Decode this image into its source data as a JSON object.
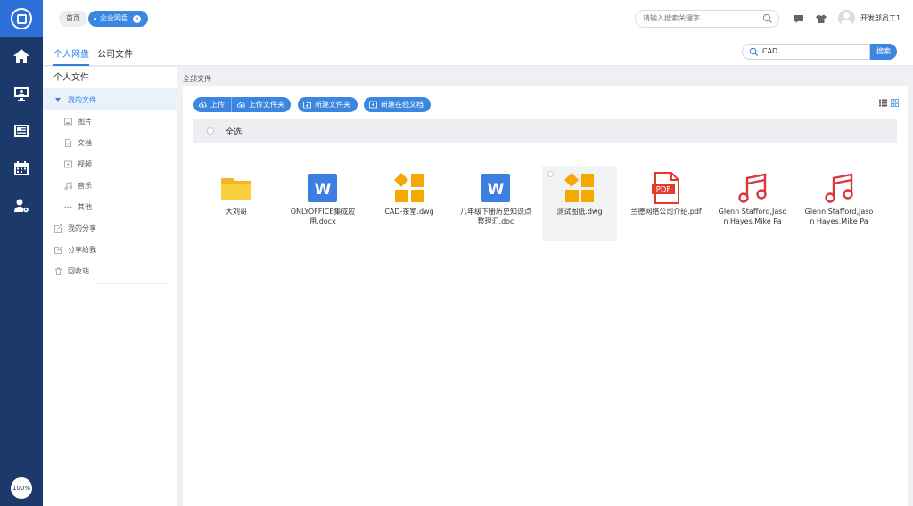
{
  "rail": {
    "items": [
      "home-icon",
      "monitor-user-icon",
      "news-icon",
      "calendar-icon",
      "user-settings-icon"
    ],
    "zoom": "100%"
  },
  "header": {
    "crumb_home": "首页",
    "crumb_tab": "企业网盘",
    "search_placeholder": "请输入搜索关键字",
    "username": "开发部员工1"
  },
  "tabs": {
    "items": [
      {
        "label": "个人网盘",
        "active": true
      },
      {
        "label": "公司文件",
        "active": false
      }
    ],
    "search_value": "CAD",
    "search_button": "搜索"
  },
  "tree": {
    "title": "个人文件",
    "my_files": "我的文件",
    "sub": [
      {
        "label": "图片",
        "icon": "image-icon"
      },
      {
        "label": "文档",
        "icon": "document-icon"
      },
      {
        "label": "视频",
        "icon": "video-icon"
      },
      {
        "label": "音乐",
        "icon": "music-icon"
      },
      {
        "label": "其他",
        "icon": "more-icon"
      }
    ],
    "links": [
      {
        "label": "我的分享",
        "icon": "share-icon"
      },
      {
        "label": "分享给我",
        "icon": "shared-with-me-icon"
      },
      {
        "label": "回收站",
        "icon": "trash-icon"
      }
    ]
  },
  "main": {
    "crumb": "全部文件",
    "toolbar": {
      "upload": "上传",
      "upload_folder": "上传文件夹",
      "new_folder": "新建文件夹",
      "new_online_doc": "新建在线文档"
    },
    "select_all": "全选",
    "files": [
      {
        "name": "大刘哥",
        "type": "folder"
      },
      {
        "name": "ONLYOFFICE集成应用.docx",
        "type": "word"
      },
      {
        "name": "CAD-茶室.dwg",
        "type": "dwg"
      },
      {
        "name": "八年级下册历史知识点整理汇.doc",
        "type": "word"
      },
      {
        "name": "测试图纸.dwg",
        "type": "dwg"
      },
      {
        "name": "兰德网络公司介绍.pdf",
        "type": "pdf"
      },
      {
        "name": "Glenn Stafford,Jason Hayes,Mike Pa",
        "type": "music"
      },
      {
        "name": "Glenn Stafford,Jason Hayes,Mike Pa",
        "type": "music"
      }
    ]
  },
  "colors": {
    "rail": "#1b3a6b",
    "accent": "#3a86e0",
    "folder": "#f7c12c",
    "dwg": "#f5a800",
    "word": "#3d7fe0",
    "pdf": "#e23b2e",
    "music": "#d9373a"
  }
}
